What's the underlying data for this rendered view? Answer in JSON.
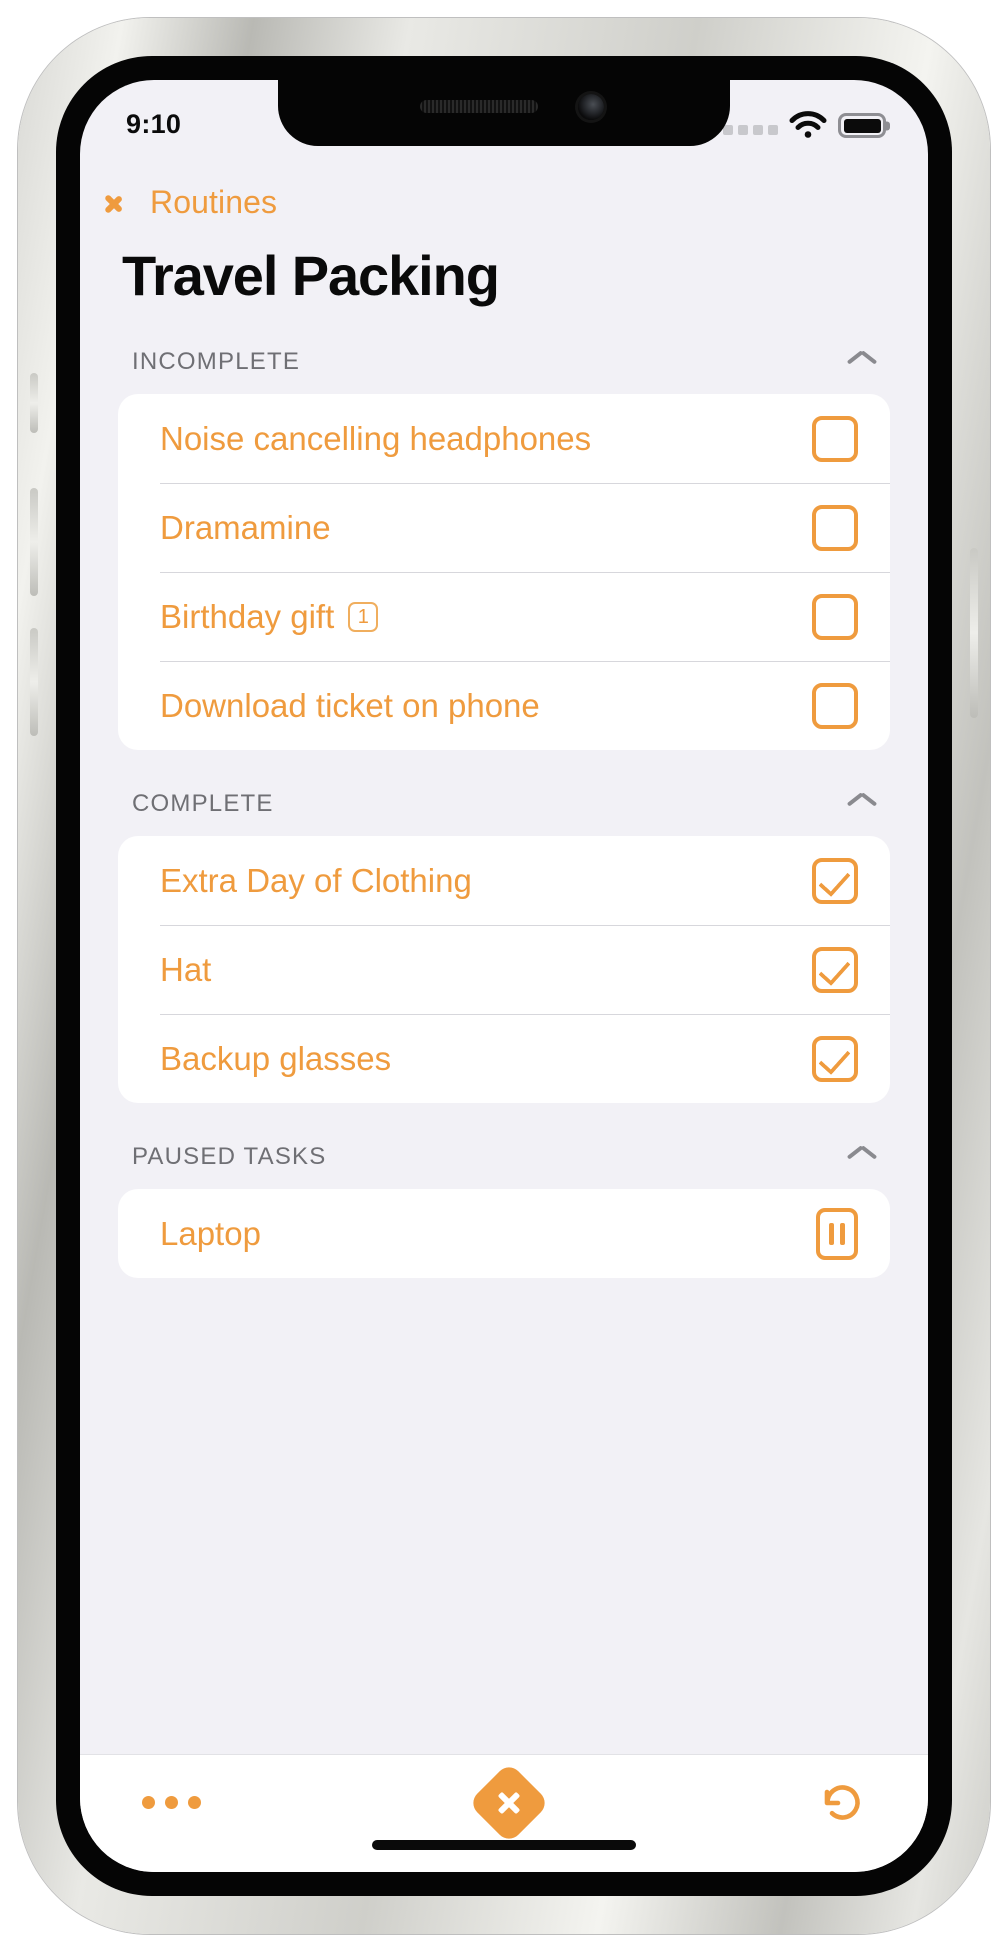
{
  "status_bar": {
    "time": "9:10",
    "signal_icon": "signal-dots-icon",
    "wifi_icon": "wifi-icon",
    "battery_icon": "battery-full-icon"
  },
  "nav": {
    "back_label": "Routines",
    "back_icon": "chevron-left-icon"
  },
  "header": {
    "title": "Travel Packing"
  },
  "theme": {
    "accent": "#ef9b3e",
    "background": "#f2f1f6",
    "card": "#ffffff",
    "section_label": "#6f6f74"
  },
  "sections": [
    {
      "title": "INCOMPLETE",
      "collapse_icon": "chevron-up-icon",
      "items": [
        {
          "label": "Noise cancelling headphones",
          "state": "unchecked",
          "badge": null
        },
        {
          "label": "Dramamine",
          "state": "unchecked",
          "badge": null
        },
        {
          "label": "Birthday gift",
          "state": "unchecked",
          "badge": "1"
        },
        {
          "label": "Download ticket on phone",
          "state": "unchecked",
          "badge": null
        }
      ]
    },
    {
      "title": "COMPLETE",
      "collapse_icon": "chevron-up-icon",
      "items": [
        {
          "label": "Extra Day of Clothing",
          "state": "checked",
          "badge": null
        },
        {
          "label": "Hat",
          "state": "checked",
          "badge": null
        },
        {
          "label": "Backup glasses",
          "state": "checked",
          "badge": null
        }
      ]
    },
    {
      "title": "PAUSED TASKS",
      "collapse_icon": "chevron-up-icon",
      "items": [
        {
          "label": "Laptop",
          "state": "paused",
          "badge": null
        }
      ]
    }
  ],
  "toolbar": {
    "more_icon": "ellipsis-icon",
    "add_icon": "plus-diamond-icon",
    "undo_icon": "undo-arrow-icon"
  }
}
